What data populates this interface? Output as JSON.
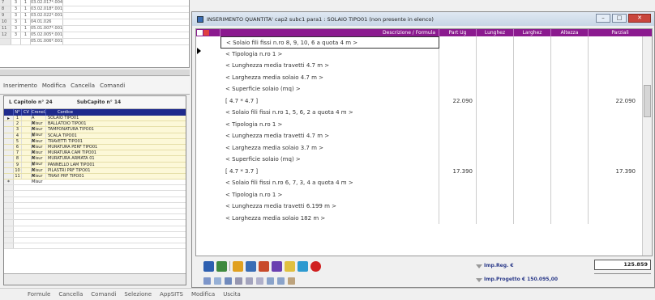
{
  "background_table": {
    "rows": [
      {
        "n": "7",
        "a": "3",
        "b": "1",
        "code": "03.02.017*.004"
      },
      {
        "n": "8",
        "a": "3",
        "b": "1",
        "code": "03.02.018*.001"
      },
      {
        "n": "9",
        "a": "3",
        "b": "1",
        "code": "03.02.022*.001"
      },
      {
        "n": "10",
        "a": "3",
        "b": "1",
        "code": "04.01.026"
      },
      {
        "n": "11",
        "a": "3",
        "b": "1",
        "code": "05.01.007*.001"
      },
      {
        "n": "12",
        "a": "3",
        "b": "1",
        "code": "05.02.005*.001"
      },
      {
        "n": "",
        "a": "",
        "b": "",
        "code": "05.01.006*.001"
      }
    ]
  },
  "left_tabs": [
    "Inserimento",
    "Modifica",
    "Cancella",
    "Comandi"
  ],
  "left_panel": {
    "capitolo": "L Capitolo n° 24",
    "subcapitolo": "SubCapito n° 14",
    "columns": [
      "N°",
      "CV",
      "Cronol.",
      "Cordice"
    ],
    "rows": [
      {
        "n": "1",
        "type": "A Misur",
        "name": "SOLAIO TIPO01"
      },
      {
        "n": "2",
        "type": "A Misur",
        "name": "BALLATOIO TIPO01"
      },
      {
        "n": "3",
        "type": "A Misur",
        "name": "TAMPONATURA TIPO01"
      },
      {
        "n": "4",
        "type": "A Misur",
        "name": "SCALA TIPO01"
      },
      {
        "n": "5",
        "type": "A Misur",
        "name": "TRAVETTI TIPO01"
      },
      {
        "n": "6",
        "type": "A Misur",
        "name": "MURATURA PERF TIPO01"
      },
      {
        "n": "7",
        "type": "A Misur",
        "name": "MURATURA CAM TIPO01"
      },
      {
        "n": "8",
        "type": "A Misur",
        "name": "MURATURA ARMATA 01"
      },
      {
        "n": "9",
        "type": "A Misur",
        "name": "PANNELLO LAM TIPO01"
      },
      {
        "n": "10",
        "type": "A Misur",
        "name": "PILASTRI PRF TIPO01"
      },
      {
        "n": "11",
        "type": "A Misur",
        "name": "TRAVI PRF TIPO01"
      }
    ]
  },
  "bottom_menu": [
    "Formule",
    "Cancella",
    "Comandi",
    "Selezione",
    "AppSITS",
    "Modifica",
    "Uscita"
  ],
  "dialog": {
    "title": "INSERIMENTO QUANTITA' cap2 subc1 para1 : SOLAIO TIPO01 (non presente in elenco)",
    "buttons": {
      "min": "–",
      "max": "□",
      "close": "✕"
    },
    "columns": {
      "desc": "Descrizione / Formula",
      "partug": "Part Ug",
      "lung": "Lunghez",
      "larg": "Larghez",
      "alt": "Altezza",
      "parz": "Parziali"
    },
    "rows": [
      {
        "desc": "< Solaio fili fissi n.ro 8, 9, 10, 6 a quota 4 m >",
        "partug": "",
        "parz": ""
      },
      {
        "desc": "< Tipologia n.ro 1 >",
        "partug": "",
        "parz": ""
      },
      {
        "desc": "< Lunghezza media travetti 4.7 m >",
        "partug": "",
        "parz": ""
      },
      {
        "desc": "< Larghezza media solaio 4.7 m >",
        "partug": "",
        "parz": ""
      },
      {
        "desc": "< Superficie solaio (mq) >",
        "partug": "",
        "parz": ""
      },
      {
        "desc": "[ 4.7 * 4.7 ]",
        "partug": "22.090",
        "parz": "22.090"
      },
      {
        "desc": "< Solaio fili fissi n.ro 1, 5, 6, 2 a quota 4 m >",
        "partug": "",
        "parz": ""
      },
      {
        "desc": "< Tipologia n.ro 1 >",
        "partug": "",
        "parz": ""
      },
      {
        "desc": "< Lunghezza media travetti 4.7 m >",
        "partug": "",
        "parz": ""
      },
      {
        "desc": "< Larghezza media solaio 3.7 m >",
        "partug": "",
        "parz": ""
      },
      {
        "desc": "< Superficie solaio (mq) >",
        "partug": "",
        "parz": ""
      },
      {
        "desc": "[ 4.7 * 3.7 ]",
        "partug": "17.390",
        "parz": "17.390"
      },
      {
        "desc": "< Solaio fili fissi n.ro 6, 7, 3, 4 a quota 4 m >",
        "partug": "",
        "parz": ""
      },
      {
        "desc": "< Tipologia n.ro 1 >",
        "partug": "",
        "parz": ""
      },
      {
        "desc": "< Lunghezza media travetti 6.199 m >",
        "partug": "",
        "parz": ""
      },
      {
        "desc": "< Larghezza media solaio 182 m >",
        "partug": "",
        "parz": ""
      }
    ],
    "imp_reg_label": "Imp.Reg. €",
    "imp_reg_value": "125.859",
    "imp_progetto_label": "Imp.Progetto € 150.095,00"
  },
  "colors": {
    "grid_header": "#8b1a8f",
    "left_grid_header": "#1e2a8c",
    "left_row_bg": "#fcf8d8"
  }
}
